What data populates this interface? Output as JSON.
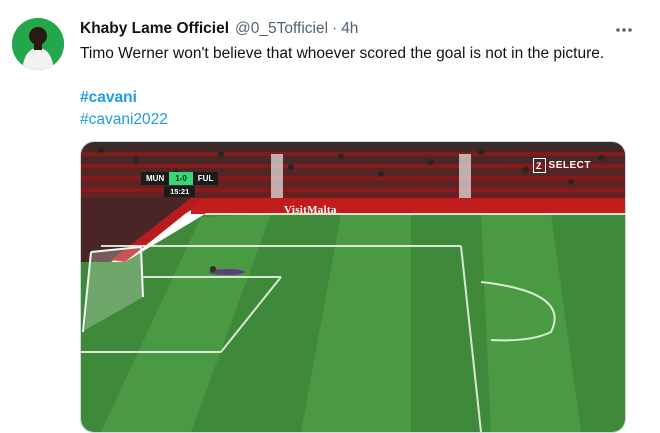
{
  "tweet": {
    "author": {
      "display_name": "Khaby Lame Officiel",
      "handle": "@0_5Tofficiel",
      "separator": "·",
      "time": "4h"
    },
    "text": "Timo Werner won't believe that whoever scored the goal is not in the picture.",
    "hashtags": [
      "#cavani",
      "#cavani2022"
    ],
    "more_icon": "more-horizontal-icon",
    "link_color": "#1d9bf0"
  },
  "media": {
    "scoreboard": {
      "home": "MUN",
      "score": "1-0",
      "away": "FUL",
      "clock": "15:21"
    },
    "banner": "VisitMalta",
    "watermark": "SELECT"
  }
}
